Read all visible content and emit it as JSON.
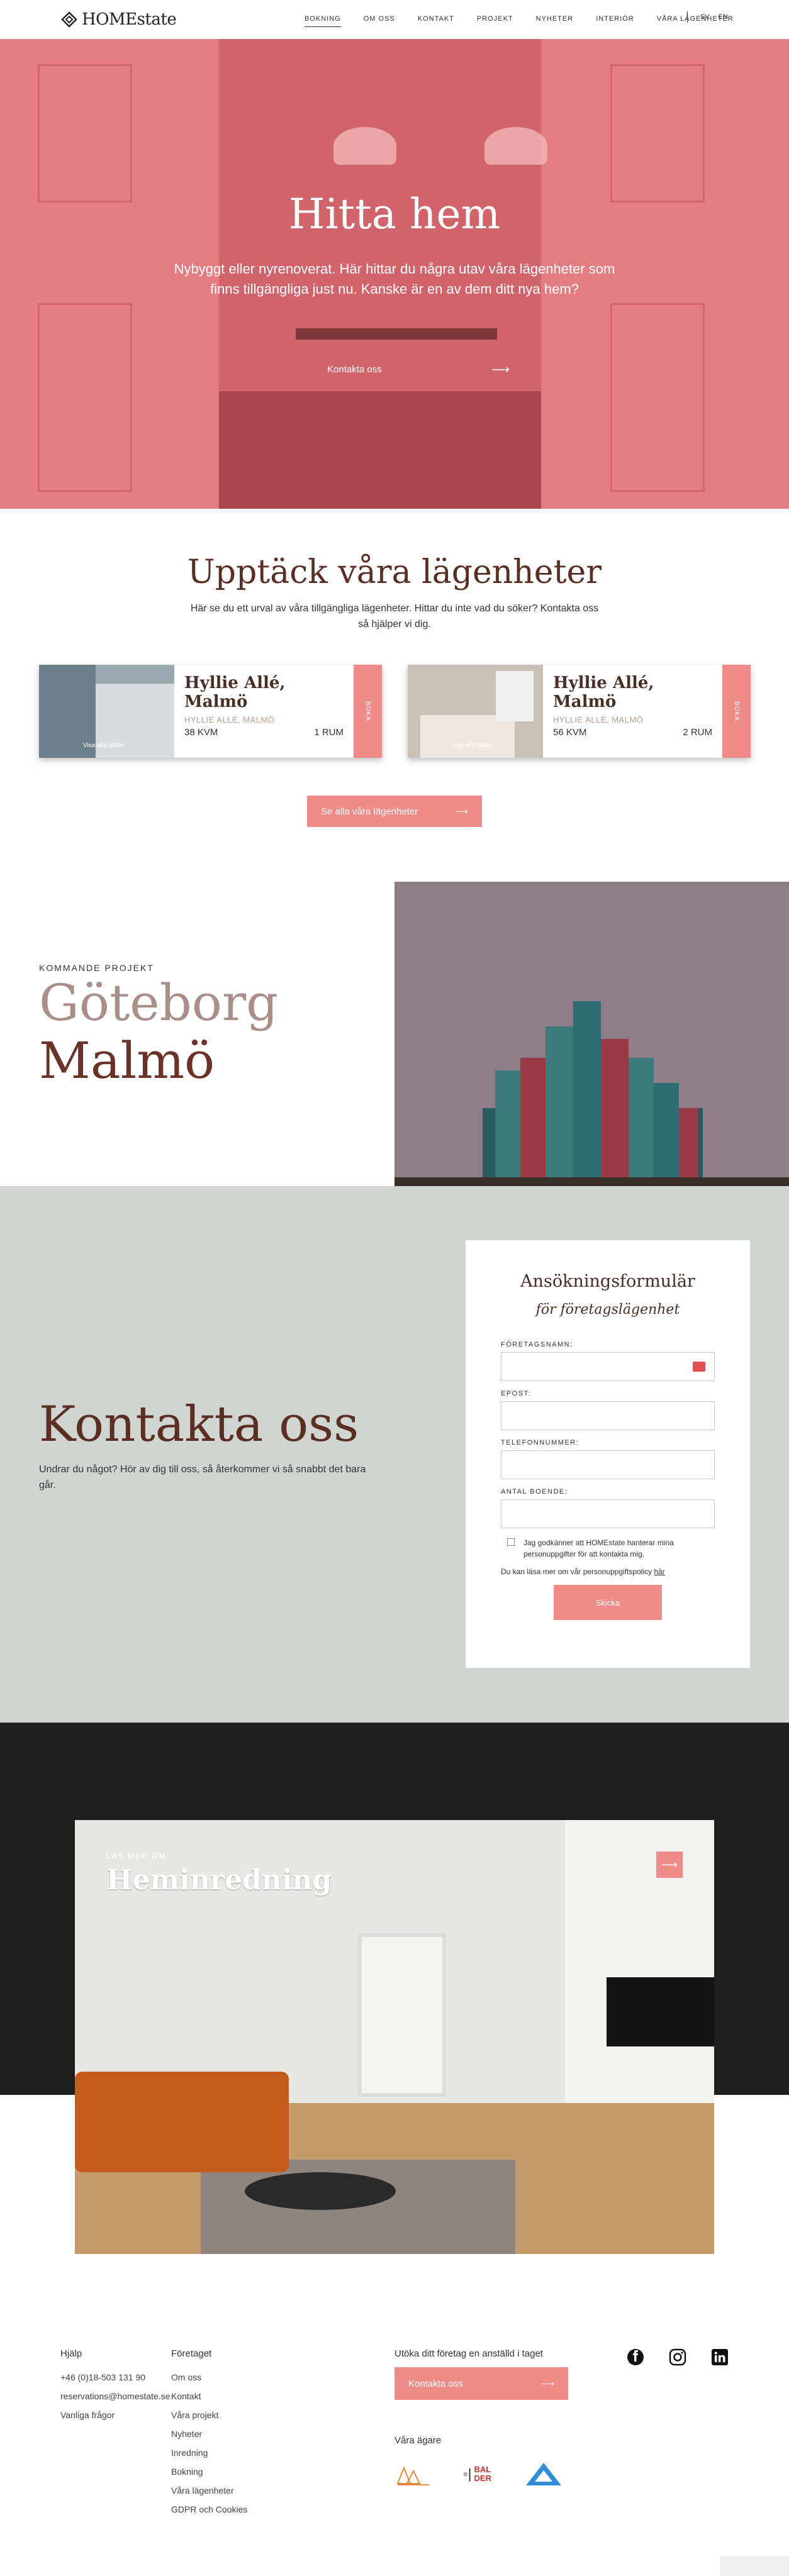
{
  "nav": {
    "logo": "HOMEstate",
    "items": [
      {
        "label": "BOKNING",
        "active": true
      },
      {
        "label": "OM OSS",
        "active": false
      },
      {
        "label": "KONTAKT",
        "active": false
      },
      {
        "label": "PROJEKT",
        "active": false
      },
      {
        "label": "NYHETER",
        "active": false
      },
      {
        "label": "INTERIÖR",
        "active": false
      },
      {
        "label": "VÅRA LÄGENHETER",
        "active": false
      }
    ],
    "lang_sv": "SV",
    "lang_en": "EN"
  },
  "hero": {
    "title": "Hitta hem",
    "subtitle": "Nybyggt eller nyrenoverat. Här hittar du några utav våra lägenheter som finns tillgängliga just nu. Kanske är en av dem ditt nya hem?",
    "cta": "Kontakta oss",
    "cta_arrow": "⟶"
  },
  "discover": {
    "title": "Upptäck våra lägenheter",
    "subtitle": "Här se du ett urval av våra tillgängliga lägenheter. Hittar du inte vad du söker? Kontakta oss så hjälper vi dig.",
    "cards": [
      {
        "title": "Hyllie Allé, Malmö",
        "location": "HYLLIE ALLÉ, MALMÖ",
        "size": "38 KVM",
        "rooms": "1 RUM",
        "tab": "BOKA",
        "tag": "Visa alla bilder"
      },
      {
        "title": "Hyllie Allé, Malmö",
        "location": "HYLLIE ALLÉ, MALMÖ",
        "size": "56 KVM",
        "rooms": "2 RUM",
        "tab": "BOKA",
        "tag": "Visa alla bilder"
      }
    ],
    "see_all": "Se alla våra lägenheter",
    "see_all_arrow": "⟶"
  },
  "projects": {
    "label": "KOMMANDE PROJEKT",
    "city1": "Göteborg",
    "city2": "Malmö"
  },
  "contact": {
    "title": "Kontakta oss",
    "subtitle": "Undrar du något? Hör av dig till oss, så återkommer vi så snabbt det bara går.",
    "form": {
      "title": "Ansökningsformulär",
      "subtitle": "för företagslägenhet",
      "company_label": "FÖRETAGSNAMN:",
      "email_label": "EPOST:",
      "phone_label": "TELEFONNUMMER:",
      "residents_label": "ANTAL BOENDE:",
      "consent": "Jag godkänner att HOMEstate hanterar mina personuppgifter för att kontakta mig.",
      "policy_prefix": "Du kan läsa mer om vår personuppgiftspolicy ",
      "policy_link": "här",
      "submit": "Skicka"
    }
  },
  "interior": {
    "kicker": "LÄS MER OM",
    "title": "Heminredning",
    "arrow": "⟶"
  },
  "footer": {
    "help_title": "Hjälp",
    "help_links": [
      "+46 (0)18-503 131 90",
      "reservations@homestate.se",
      "Vanliga frågor"
    ],
    "company_title": "Företaget",
    "company_links": [
      "Om oss",
      "Kontakt",
      "Våra projekt",
      "Nyheter",
      "Inredning",
      "Bokning",
      "Våra lägenheter",
      "GDPR och Cookies"
    ],
    "cta_title": "Utöka ditt företag en anställd i taget",
    "cta_btn": "Kontakta oss",
    "cta_arrow": "⟶",
    "owners_title": "Våra ägare",
    "owner_logo_2": "BAL DER"
  },
  "colors": {
    "accent": "#f08b89",
    "brown": "#5a2e22",
    "hero_pink": "#e37d82"
  }
}
